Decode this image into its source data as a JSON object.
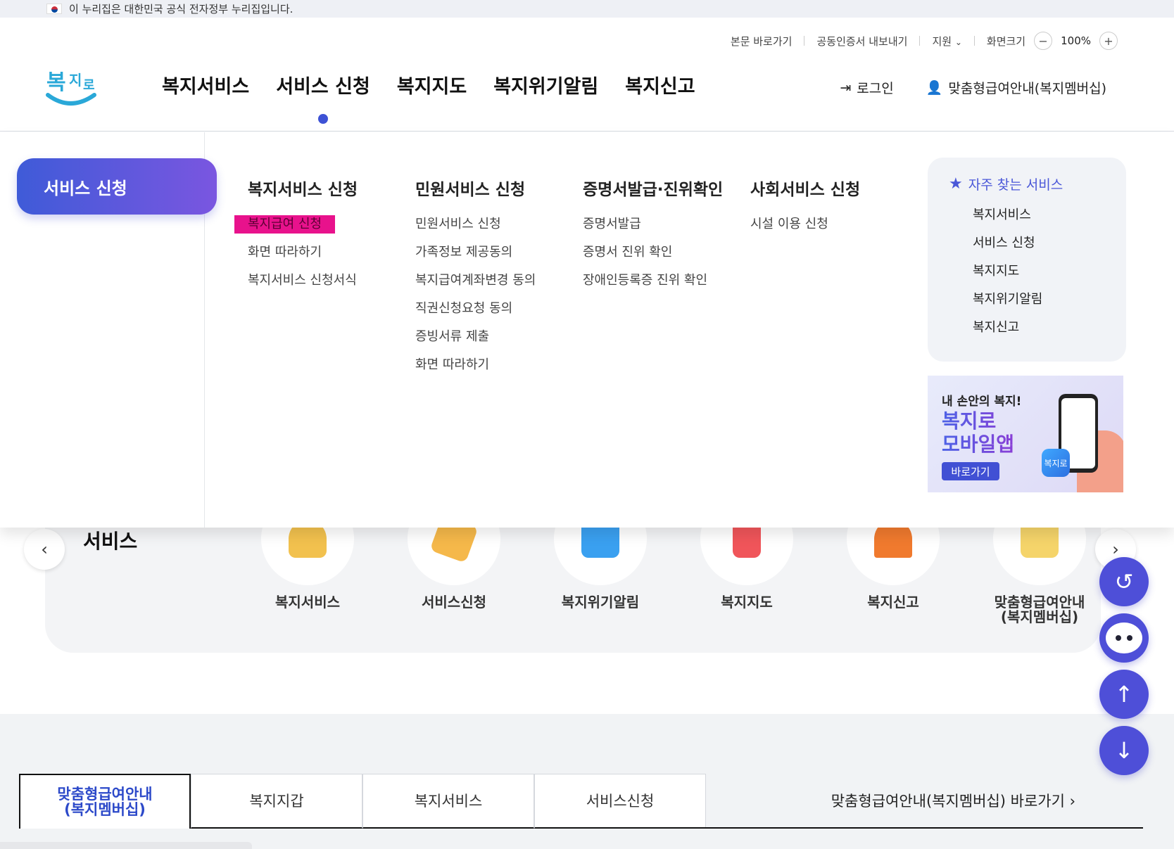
{
  "gov_banner": {
    "text": "이 누리집은 대한민국 공식 전자정부 누리집입니다."
  },
  "util": {
    "skip": "본문 바로가기",
    "cert": "공동인증서 내보내기",
    "support": "지원",
    "zoom_label": "화면크기",
    "zoom_minus": "−",
    "zoom_value": "100%",
    "zoom_plus": "+"
  },
  "logo": {
    "text": "복지로"
  },
  "gnb": [
    "복지서비스",
    "서비스 신청",
    "복지지도",
    "복지위기알림",
    "복지신고"
  ],
  "member": {
    "login": "로그인",
    "membership": "맞춤형급여안내(복지멤버십)"
  },
  "mega": {
    "category": "서비스 신청",
    "columns": [
      {
        "title": "복지서비스 신청",
        "links": [
          "복지급여 신청",
          "화면 따라하기",
          "복지서비스 신청서식"
        ]
      },
      {
        "title": "민원서비스 신청",
        "links": [
          "민원서비스 신청",
          "가족정보 제공동의",
          "복지급여계좌변경 동의",
          "직권신청요청 동의",
          "증빙서류 제출",
          "화면 따라하기"
        ]
      },
      {
        "title": "증명서발급·진위확인",
        "links": [
          "증명서발급",
          "증명서 진위 확인",
          "장애인등록증 진위 확인"
        ]
      },
      {
        "title": "사회서비스 신청",
        "links": [
          "시설 이용 신청"
        ]
      }
    ],
    "favorites": {
      "title": "자주 찾는 서비스",
      "links": [
        "복지서비스",
        "서비스 신청",
        "복지지도",
        "복지위기알림",
        "복지신고"
      ]
    },
    "app_banner": {
      "sub": "내 손안의 복지!",
      "line1": "복지로",
      "line2": "모바일앱",
      "go": "바로가기",
      "icon_text": "복지로"
    }
  },
  "quick": {
    "title": "서비스",
    "prev": "‹",
    "next": "›",
    "items": [
      {
        "label": "복지서비스",
        "color": "#f2c14e"
      },
      {
        "label": "서비스신청",
        "color": "#f5b84a"
      },
      {
        "label": "복지위기알림",
        "color": "#3aa0f0"
      },
      {
        "label": "복지지도",
        "color": "#f0555a"
      },
      {
        "label": "복지신고",
        "color": "#f07a2e"
      },
      {
        "label": "맞춤형급여안내\n(복지멤버십)",
        "color": "#f5d46a"
      }
    ]
  },
  "floating": {
    "recent": "↺",
    "top": "↑",
    "down": "↓"
  },
  "tabs": [
    {
      "label": "맞춤형급여안내\n(복지멤버십)",
      "active": true
    },
    {
      "label": "복지지갑",
      "active": false
    },
    {
      "label": "복지서비스",
      "active": false
    },
    {
      "label": "서비스신청",
      "active": false
    }
  ],
  "shortcut": "맞춤형급여안내(복지멤버십) 바로가기 ›",
  "colors": {
    "accent": "#3d52d5",
    "highlight": "#e8128c",
    "gradient_start": "#3f5bd8",
    "gradient_end": "#7a56e0"
  }
}
